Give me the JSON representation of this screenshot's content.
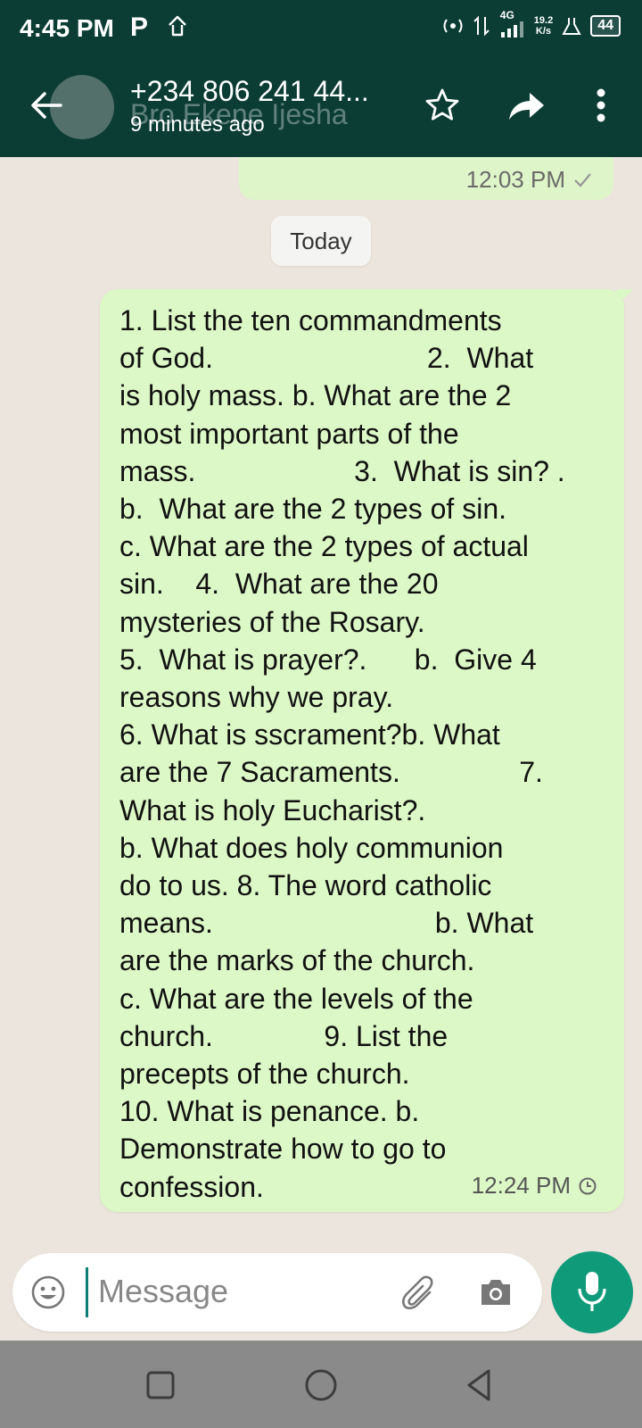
{
  "status_bar": {
    "time": "4:45 PM",
    "p_icon": "P",
    "network": "4G",
    "speed_value": "19.2",
    "speed_unit": "K/s",
    "battery": "44"
  },
  "header": {
    "contact_name": "+234 806 241 44...",
    "contact_ghost_name": "Bro Ekene Ijesha",
    "last_seen": "9 minutes ago",
    "icons": [
      "back-arrow-icon",
      "star-icon",
      "forward-icon",
      "more-vert-icon"
    ]
  },
  "chat": {
    "previous_message_time": "12:03 PM",
    "date_divider": "Today",
    "message": {
      "text": "1. List the ten commandments\nof God.                           2.  What\nis holy mass. b. What are the 2\nmost important parts of the\nmass.                    3.  What is sin? .\nb.  What are the 2 types of sin.\nc. What are the 2 types of actual\nsin.    4.  What are the 20\nmysteries of the Rosary.\n5.  What is prayer?.      b.  Give 4\nreasons why we pray.\n6. What is sscrament?b. What\nare the 7 Sacraments.               7.\nWhat is holy Eucharist?.\nb. What does holy communion\ndo to us. 8. The word catholic\nmeans.                            b. What\nare the marks of the church.\nc. What are the levels of the\nchurch.              9. List the\nprecepts of the church.\n10. What is penance. b.\nDemonstrate how to go to\nconfession.",
      "time": "12:24 PM",
      "status_icon": "clock-pending-icon"
    }
  },
  "composer": {
    "placeholder": "Message",
    "icons": [
      "emoji-icon",
      "attach-icon",
      "camera-icon",
      "mic-icon"
    ]
  },
  "colors": {
    "header_bg": "#0b3d35",
    "chat_bg": "#ece5dd",
    "outgoing_bubble": "#dcf8c6",
    "accent_green": "#0f9b7a",
    "navbar_bg": "#8a8a8a"
  }
}
